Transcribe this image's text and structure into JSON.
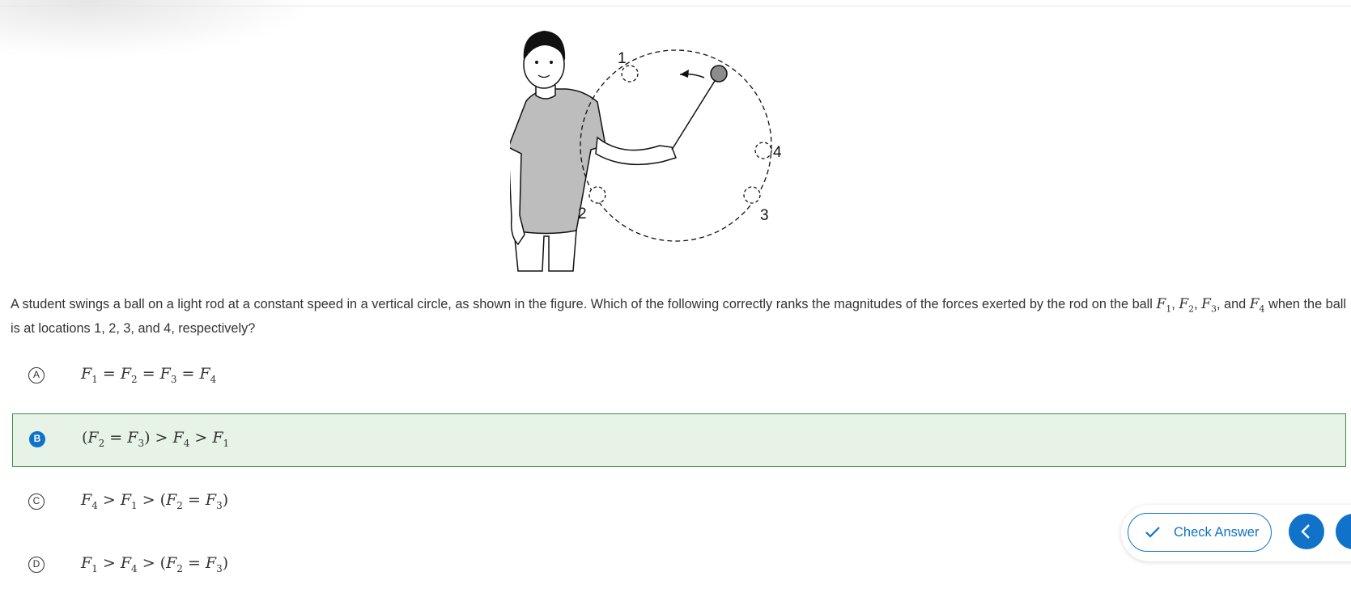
{
  "question": {
    "before": "A student swings a ball on a light rod at a constant speed in a vertical circle, as shown in the figure. Which of the following correctly ranks the magnitudes of the forces exerted by the rod on the ball",
    "after": "when the ball is at locations 1, 2, 3, and 4, respectively?",
    "and_word": "and"
  },
  "figure": {
    "labels": [
      "1",
      "2",
      "3",
      "4"
    ]
  },
  "choices": [
    {
      "letter": "A",
      "selected": false,
      "expression": "F1 = F2 = F3 = F4"
    },
    {
      "letter": "B",
      "selected": true,
      "expression": "(F2 = F3) > F4 > F1"
    },
    {
      "letter": "C",
      "selected": false,
      "expression": "F4 > F1 > (F2 = F3)"
    },
    {
      "letter": "D",
      "selected": false,
      "expression": "F1 > F4 > (F2 = F3)"
    }
  ],
  "toolbar": {
    "check_label": "Check Answer",
    "check_icon": "check-icon",
    "prev_icon": "chevron-left-icon",
    "accent_color": "#1172c9"
  },
  "selection_color": "#e8f3e7"
}
